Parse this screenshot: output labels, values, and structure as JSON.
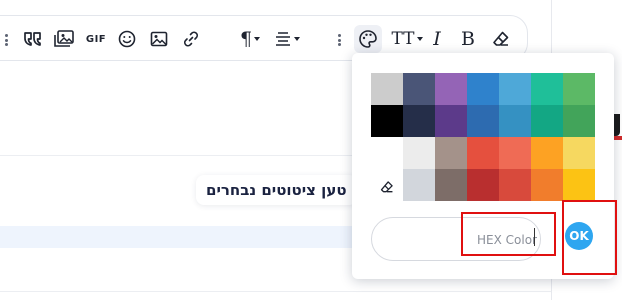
{
  "toolbar": {
    "items": [
      {
        "name": "grip-handle-left-icon"
      },
      {
        "name": "quote-icon"
      },
      {
        "name": "image-gallery-icon"
      },
      {
        "name": "gif-button",
        "label": "GIF"
      },
      {
        "name": "emoji-icon"
      },
      {
        "name": "image-icon"
      },
      {
        "name": "link-icon"
      },
      {
        "name": "paragraph-icon",
        "label": "¶",
        "has_dropdown": true
      },
      {
        "name": "align-icon",
        "has_dropdown": true
      },
      {
        "name": "grip-handle-right-icon"
      },
      {
        "name": "palette-icon",
        "active": true
      },
      {
        "name": "text-size-icon",
        "label": "TT",
        "has_dropdown": true
      },
      {
        "name": "italic-icon",
        "label": "I"
      },
      {
        "name": "bold-icon",
        "label": "B"
      },
      {
        "name": "eraser-icon"
      }
    ]
  },
  "content": {
    "heading_text": "טען ציטוטים נבחרים"
  },
  "color_picker": {
    "swatches": [
      "#cccccc",
      "#4a5577",
      "#9464b6",
      "#2f82cc",
      "#4ea8d8",
      "#1fbf99",
      "#5cb966",
      "#000000",
      "#252e49",
      "#5c3a8a",
      "#2d6bb0",
      "#3591c2",
      "#13a784",
      "#42a45a",
      "",
      "#ececec",
      "#a4928a",
      "#e5503e",
      "#ef6b55",
      "#fda223",
      "#f6d860",
      "",
      "#d2d6dc",
      "#7d6d68",
      "#b92f2f",
      "#d84a3c",
      "#f17d2c",
      "#fcc314"
    ],
    "clear_icon": "eraser-icon",
    "hex_placeholder": "HEX Color",
    "ok_label": "OK",
    "ok_color": "#2ea6f0"
  },
  "highlight_color": "#e01010"
}
